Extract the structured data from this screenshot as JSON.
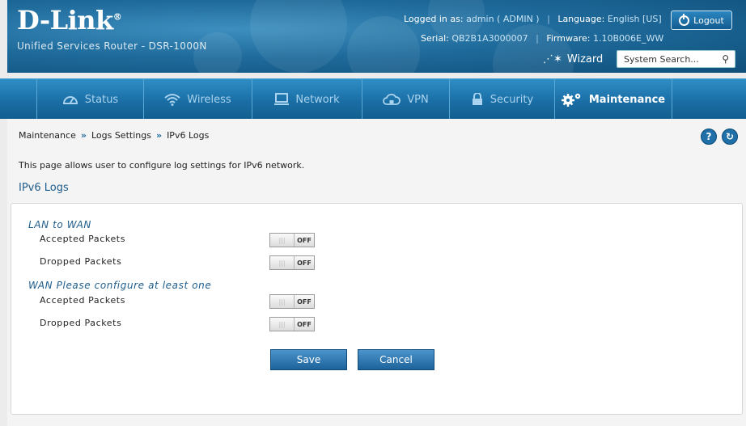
{
  "header": {
    "logo": "D-Link",
    "model": "Unified Services Router - DSR-1000N",
    "logged_in_label": "Logged in as:",
    "logged_in_value": "admin ( ADMIN )",
    "language_label": "Language:",
    "language_value": "English [US]",
    "serial_label": "Serial:",
    "serial_value": "QB2B1A3000007",
    "firmware_label": "Firmware:",
    "firmware_value": "1.10B006E_WW",
    "logout_label": "Logout",
    "wizard_label": "Wizard",
    "search_placeholder": "System Search..."
  },
  "nav": {
    "tabs": [
      {
        "label": "Status",
        "icon": "dashboard-icon"
      },
      {
        "label": "Wireless",
        "icon": "wifi-icon"
      },
      {
        "label": "Network",
        "icon": "monitor-icon"
      },
      {
        "label": "VPN",
        "icon": "cloud-lock-icon"
      },
      {
        "label": "Security",
        "icon": "lock-icon"
      },
      {
        "label": "Maintenance",
        "icon": "gears-icon",
        "active": true
      }
    ]
  },
  "breadcrumb": [
    "Maintenance",
    "Logs Settings",
    "IPv6 Logs"
  ],
  "page": {
    "description": "This page allows user to configure log settings for IPv6 network.",
    "section_title": "IPv6 Logs"
  },
  "form": {
    "lan_group": "LAN to WAN",
    "wan_group": "WAN Please configure at least one",
    "lan_accepted_label": "Accepted Packets",
    "lan_dropped_label": "Dropped Packets",
    "wan_accepted_label": "Accepted Packets",
    "wan_dropped_label": "Dropped Packets",
    "toggle_state": "OFF",
    "toggle_grip": "|||"
  },
  "buttons": {
    "save": "Save",
    "cancel": "Cancel"
  },
  "colors": {
    "brand_blue": "#1f6b9c",
    "nav_blue": "#1a6fa6",
    "accent": "#1f5d8c"
  }
}
